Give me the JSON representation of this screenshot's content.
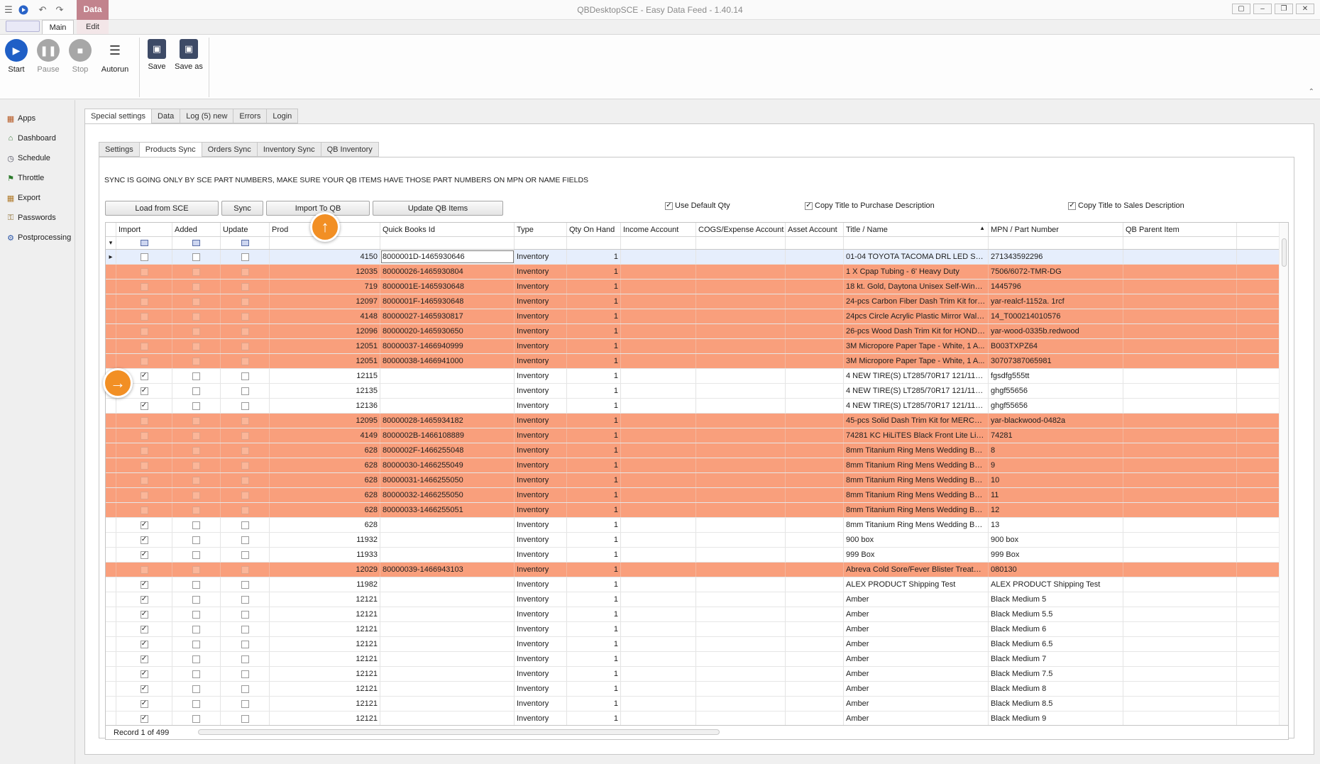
{
  "window": {
    "title": "QBDesktopSCE - Easy Data Feed - 1.40.14",
    "context_tab": "Data",
    "ribbon_tabs": [
      "Main",
      "Edit"
    ]
  },
  "ribbon": {
    "start": "Start",
    "pause": "Pause",
    "stop": "Stop",
    "autorun": "Autorun",
    "save": "Save",
    "save_as": "Save as"
  },
  "sidebar": {
    "items": [
      {
        "label": "Apps",
        "icon": "apps-icon"
      },
      {
        "label": "Dashboard",
        "icon": "dashboard-icon"
      },
      {
        "label": "Schedule",
        "icon": "schedule-icon"
      },
      {
        "label": "Throttle",
        "icon": "throttle-icon"
      },
      {
        "label": "Export",
        "icon": "export-icon"
      },
      {
        "label": "Passwords",
        "icon": "passwords-icon"
      },
      {
        "label": "Postprocessing",
        "icon": "postprocessing-icon"
      }
    ]
  },
  "outer_tabs": [
    "Special settings",
    "Data",
    "Log (5) new",
    "Errors",
    "Login"
  ],
  "inner_tabs": [
    "Settings",
    "Products Sync",
    "Orders Sync",
    "Inventory Sync",
    "QB Inventory"
  ],
  "notice": "SYNC IS GOING ONLY BY SCE PART NUMBERS, MAKE SURE YOUR QB ITEMS HAVE THOSE PART NUMBERS ON MPN OR NAME FIELDS",
  "actions": {
    "load": "Load from SCE",
    "sync": "Sync",
    "import": "Import To QB",
    "update": "Update QB Items"
  },
  "options": {
    "use_default_qty": "Use Default Qty",
    "copy_purchase": "Copy Title to Purchase Description",
    "copy_sales": "Copy Title to Sales Description"
  },
  "grid": {
    "columns": [
      "Import",
      "Added",
      "Update",
      "Prod",
      "Quick Books Id",
      "Type",
      "Qty On Hand",
      "Income Account",
      "COGS/Expense Account",
      "Asset Account",
      "Title / Name",
      "MPN / Part Number",
      "QB Parent Item"
    ],
    "rows": [
      {
        "import": false,
        "prod": "4150",
        "qbid": "8000001D-1465930646",
        "type": "Inventory",
        "qty": "1",
        "title": "01-04 TOYOTA TACOMA DRL LED SMO...",
        "mpn": "271343592296",
        "state": "sel"
      },
      {
        "import": false,
        "prod": "12035",
        "qbid": "80000026-1465930804",
        "type": "Inventory",
        "qty": "1",
        "title": "1 X Cpap Tubing - 6' Heavy Duty",
        "mpn": "7506/6072-TMR-DG",
        "state": "hl"
      },
      {
        "import": false,
        "prod": "719",
        "qbid": "8000001E-1465930648",
        "type": "Inventory",
        "qty": "1",
        "title": "18 kt. Gold, Daytona Unisex Self-Windi...",
        "mpn": "1445796",
        "state": "hl"
      },
      {
        "import": false,
        "prod": "12097",
        "qbid": "8000001F-1465930648",
        "type": "Inventory",
        "qty": "1",
        "title": "24-pcs Carbon Fiber Dash Trim Kit for ...",
        "mpn": "yar-realcf-1152a. 1rcf",
        "state": "hl"
      },
      {
        "import": false,
        "prod": "4148",
        "qbid": "80000027-1465930817",
        "type": "Inventory",
        "qty": "1",
        "title": "24pcs Circle Acrylic Plastic Mirror Wall ...",
        "mpn": "14_T000214010576",
        "state": "hl"
      },
      {
        "import": false,
        "prod": "12096",
        "qbid": "80000020-1465930650",
        "type": "Inventory",
        "qty": "1",
        "title": "26-pcs Wood Dash Trim Kit for HONDA...",
        "mpn": "yar-wood-0335b.redwood",
        "state": "hl"
      },
      {
        "import": false,
        "prod": "12051",
        "qbid": "80000037-1466940999",
        "type": "Inventory",
        "qty": "1",
        "title": "3M Micropore Paper Tape - White, 1 A...",
        "mpn": "B003TXPZ64",
        "state": "hl"
      },
      {
        "import": false,
        "prod": "12051",
        "qbid": "80000038-1466941000",
        "type": "Inventory",
        "qty": "1",
        "title": "3M Micropore Paper Tape - White, 1 A...",
        "mpn": "30707387065981",
        "state": "hl"
      },
      {
        "import": true,
        "prod": "12115",
        "qbid": "",
        "type": "Inventory",
        "qty": "1",
        "title": "4 NEW TIRE(S) LT285/70R17 121/118...",
        "mpn": "fgsdfg555tt",
        "state": ""
      },
      {
        "import": true,
        "prod": "12135",
        "qbid": "",
        "type": "Inventory",
        "qty": "1",
        "title": "4 NEW TIRE(S) LT285/70R17 121/118...",
        "mpn": "ghgf55656",
        "state": ""
      },
      {
        "import": true,
        "prod": "12136",
        "qbid": "",
        "type": "Inventory",
        "qty": "1",
        "title": "4 NEW TIRE(S) LT285/70R17 121/118...",
        "mpn": "ghgf55656",
        "state": ""
      },
      {
        "import": false,
        "prod": "12095",
        "qbid": "80000028-1465934182",
        "type": "Inventory",
        "qty": "1",
        "title": "45-pcs Solid Dash Trim Kit for MERCED...",
        "mpn": "yar-blackwood-0482a",
        "state": "hl"
      },
      {
        "import": false,
        "prod": "4149",
        "qbid": "8000002B-1466108889",
        "type": "Inventory",
        "qty": "1",
        "title": "74281 KC HiLiTES Black Front Lite Light...",
        "mpn": "74281",
        "state": "hl"
      },
      {
        "import": false,
        "prod": "628",
        "qbid": "8000002F-1466255048",
        "type": "Inventory",
        "qty": "1",
        "title": "8mm Titanium Ring Mens Wedding Ban ...",
        "mpn": "8",
        "state": "hl"
      },
      {
        "import": false,
        "prod": "628",
        "qbid": "80000030-1466255049",
        "type": "Inventory",
        "qty": "1",
        "title": "8mm Titanium Ring Mens Wedding Ban ...",
        "mpn": "9",
        "state": "hl"
      },
      {
        "import": false,
        "prod": "628",
        "qbid": "80000031-1466255050",
        "type": "Inventory",
        "qty": "1",
        "title": "8mm Titanium Ring Mens Wedding Ban ...",
        "mpn": "10",
        "state": "hl"
      },
      {
        "import": false,
        "prod": "628",
        "qbid": "80000032-1466255050",
        "type": "Inventory",
        "qty": "1",
        "title": "8mm Titanium Ring Mens Wedding Ban ...",
        "mpn": "11",
        "state": "hl"
      },
      {
        "import": false,
        "prod": "628",
        "qbid": "80000033-1466255051",
        "type": "Inventory",
        "qty": "1",
        "title": "8mm Titanium Ring Mens Wedding Ban ...",
        "mpn": "12",
        "state": "hl"
      },
      {
        "import": true,
        "prod": "628",
        "qbid": "",
        "type": "Inventory",
        "qty": "1",
        "title": "8mm Titanium Ring Mens Wedding Ban ...",
        "mpn": "13",
        "state": ""
      },
      {
        "import": true,
        "prod": "11932",
        "qbid": "",
        "type": "Inventory",
        "qty": "1",
        "title": "900 box",
        "mpn": "900 box",
        "state": ""
      },
      {
        "import": true,
        "prod": "11933",
        "qbid": "",
        "type": "Inventory",
        "qty": "1",
        "title": "999 Box",
        "mpn": "999 Box",
        "state": ""
      },
      {
        "import": false,
        "prod": "12029",
        "qbid": "80000039-1466943103",
        "type": "Inventory",
        "qty": "1",
        "title": "Abreva Cold Sore/Fever Blister Treatm...",
        "mpn": "080130",
        "state": "hl"
      },
      {
        "import": true,
        "prod": "11982",
        "qbid": "",
        "type": "Inventory",
        "qty": "1",
        "title": "ALEX PRODUCT Shipping Test",
        "mpn": "ALEX PRODUCT Shipping Test",
        "state": ""
      },
      {
        "import": true,
        "prod": "12121",
        "qbid": "",
        "type": "Inventory",
        "qty": "1",
        "title": "Amber",
        "mpn": "Black Medium 5",
        "state": ""
      },
      {
        "import": true,
        "prod": "12121",
        "qbid": "",
        "type": "Inventory",
        "qty": "1",
        "title": "Amber",
        "mpn": "Black Medium 5.5",
        "state": ""
      },
      {
        "import": true,
        "prod": "12121",
        "qbid": "",
        "type": "Inventory",
        "qty": "1",
        "title": "Amber",
        "mpn": "Black Medium 6",
        "state": ""
      },
      {
        "import": true,
        "prod": "12121",
        "qbid": "",
        "type": "Inventory",
        "qty": "1",
        "title": "Amber",
        "mpn": "Black Medium 6.5",
        "state": ""
      },
      {
        "import": true,
        "prod": "12121",
        "qbid": "",
        "type": "Inventory",
        "qty": "1",
        "title": "Amber",
        "mpn": "Black Medium 7",
        "state": ""
      },
      {
        "import": true,
        "prod": "12121",
        "qbid": "",
        "type": "Inventory",
        "qty": "1",
        "title": "Amber",
        "mpn": "Black Medium 7.5",
        "state": ""
      },
      {
        "import": true,
        "prod": "12121",
        "qbid": "",
        "type": "Inventory",
        "qty": "1",
        "title": "Amber",
        "mpn": "Black Medium 8",
        "state": ""
      },
      {
        "import": true,
        "prod": "12121",
        "qbid": "",
        "type": "Inventory",
        "qty": "1",
        "title": "Amber",
        "mpn": "Black Medium 8.5",
        "state": ""
      },
      {
        "import": true,
        "prod": "12121",
        "qbid": "",
        "type": "Inventory",
        "qty": "1",
        "title": "Amber",
        "mpn": "Black Medium 9",
        "state": ""
      }
    ],
    "record_label": "Record 1 of 499"
  },
  "colors": {
    "highlight_row": "#f99f7c",
    "selected_row": "#e6eefc",
    "callout": "#f28f24",
    "context_tab": "#c2838d"
  }
}
